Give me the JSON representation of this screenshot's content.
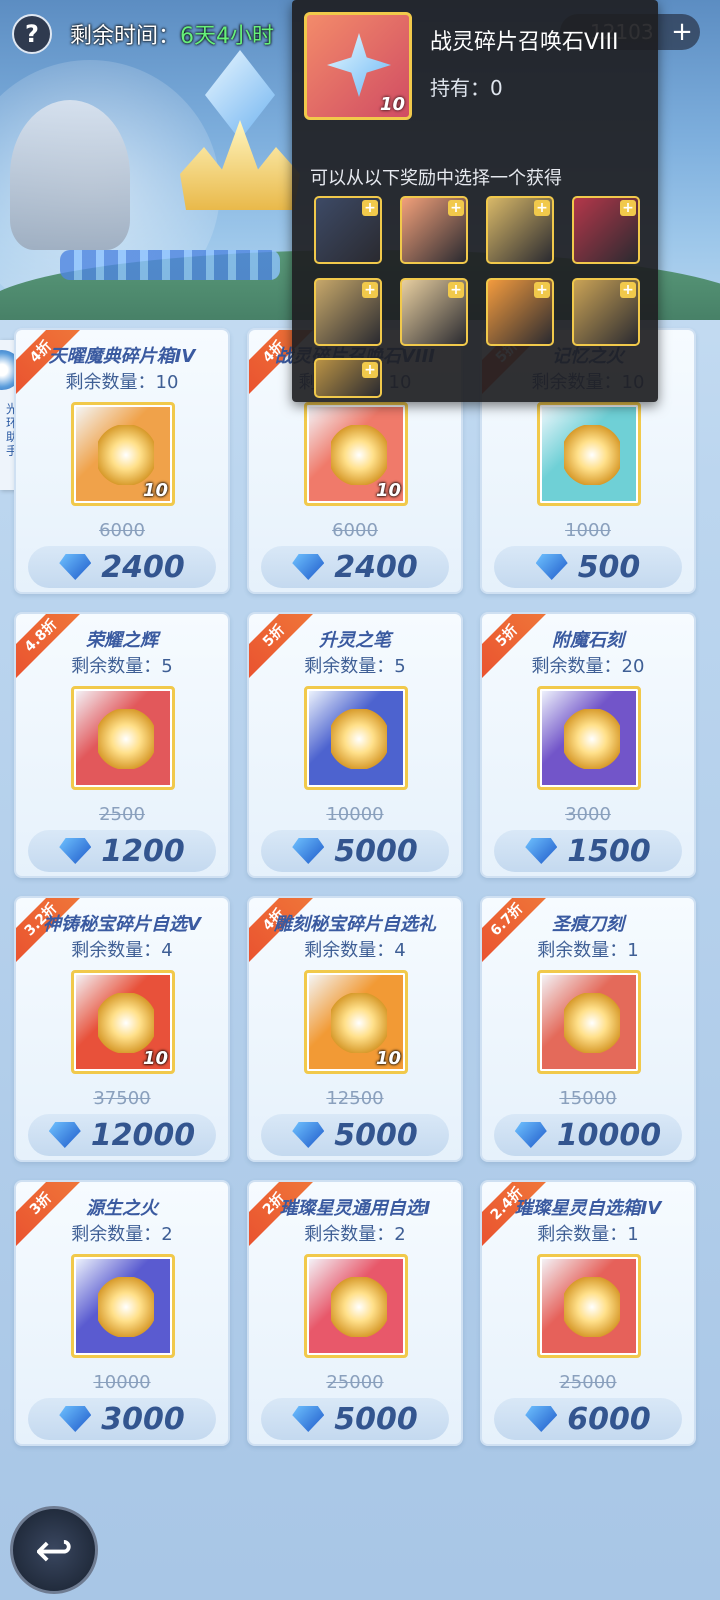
{
  "header": {
    "help_label": "?",
    "time_label": "剩余时间：",
    "time_value": "6天4小时",
    "currency_amount": "12103",
    "plus_label": "+"
  },
  "side_tab": {
    "label": "光环助手"
  },
  "cards": [
    {
      "discount": "4折",
      "name": "天曜魔典碎片箱IV",
      "stock": "剩余数量：10",
      "qty": "10",
      "old_price": "6000",
      "price": "2400",
      "icon": "cube-chest-icon",
      "bg": "#f0a24a"
    },
    {
      "discount": "4折",
      "name": "战灵碎片召唤石VIII",
      "stock": "剩余数量：10",
      "qty": "10",
      "old_price": "6000",
      "price": "2400",
      "icon": "summon-star-icon",
      "bg": "#f07a6a"
    },
    {
      "discount": "5折",
      "name": "记忆之火",
      "stock": "剩余数量：10",
      "qty": "",
      "old_price": "1000",
      "price": "500",
      "icon": "memory-flame-icon",
      "bg": "#6fd0d6"
    },
    {
      "discount": "4.8折",
      "name": "荣耀之辉",
      "stock": "剩余数量：5",
      "qty": "",
      "old_price": "2500",
      "price": "1200",
      "icon": "glory-orb-icon",
      "bg": "#e2585b"
    },
    {
      "discount": "5折",
      "name": "升灵之笔",
      "stock": "剩余数量：5",
      "qty": "",
      "old_price": "10000",
      "price": "5000",
      "icon": "quill-icon",
      "bg": "#4d63cf"
    },
    {
      "discount": "5折",
      "name": "附魔石刻",
      "stock": "剩余数量：20",
      "qty": "",
      "old_price": "3000",
      "price": "1500",
      "icon": "rune-stone-icon",
      "bg": "#7255c9"
    },
    {
      "discount": "3.2折",
      "name": "神铸秘宝碎片自选V",
      "stock": "剩余数量：4",
      "qty": "10",
      "old_price": "37500",
      "price": "12000",
      "icon": "relic-altar-icon",
      "bg": "#e8513a"
    },
    {
      "discount": "4折",
      "name": "雕刻秘宝碎片自选礼",
      "stock": "剩余数量：4",
      "qty": "10",
      "old_price": "12500",
      "price": "5000",
      "icon": "relic-altar-icon",
      "bg": "#f29a35"
    },
    {
      "discount": "6.7折",
      "name": "圣痕刀刻",
      "stock": "剩余数量：1",
      "qty": "",
      "old_price": "15000",
      "price": "10000",
      "icon": "blade-icon",
      "bg": "#e46a5a"
    },
    {
      "discount": "3折",
      "name": "源生之火",
      "stock": "剩余数量：2",
      "qty": "",
      "old_price": "10000",
      "price": "3000",
      "icon": "origin-fire-icon",
      "bg": "#5a5bd0"
    },
    {
      "discount": "2折",
      "name": "璀璨星灵通用自选I",
      "stock": "剩余数量：2",
      "qty": "",
      "old_price": "25000",
      "price": "5000",
      "icon": "star-chest-icon",
      "bg": "#e8586a"
    },
    {
      "discount": "2.4折",
      "name": "璀璨星灵自选箱IV",
      "stock": "剩余数量：1",
      "qty": "",
      "old_price": "25000",
      "price": "6000",
      "icon": "star-chest-icon",
      "bg": "#e6615a"
    }
  ],
  "popup": {
    "title": "战灵碎片召唤石VIII",
    "owned": "持有：0",
    "qty": "10",
    "desc": "可以从以下奖励中选择一个获得",
    "choices": [
      {
        "icon": "werewolf-portrait-icon",
        "color": "#3d4a66"
      },
      {
        "icon": "red-hair-girl-portrait-icon",
        "color": "#f2a07a"
      },
      {
        "icon": "silver-crown-girl-portrait-icon",
        "color": "#d8b868"
      },
      {
        "icon": "crimson-mask-portrait-icon",
        "color": "#b4374a"
      },
      {
        "icon": "knight-helm-portrait-icon",
        "color": "#c7a86a"
      },
      {
        "icon": "blonde-maiden-portrait-icon",
        "color": "#e8cfa0"
      },
      {
        "icon": "fire-angel-portrait-icon",
        "color": "#f39b3e"
      },
      {
        "icon": "golden-warrior-portrait-icon",
        "color": "#caa356"
      },
      {
        "icon": "golden-armor-portrait-icon",
        "color": "#b99245"
      }
    ],
    "plus_badge": "+"
  },
  "back_label": "↩"
}
